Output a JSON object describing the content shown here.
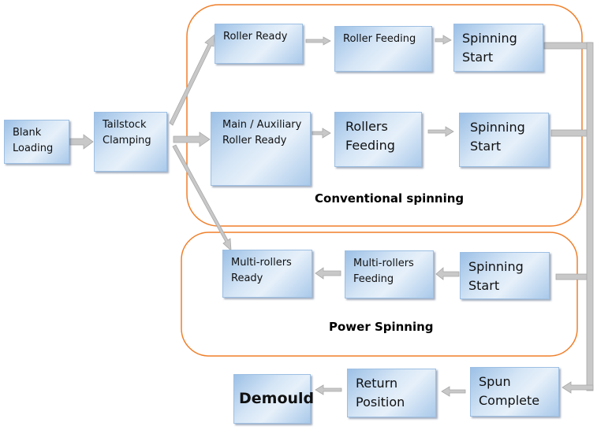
{
  "groups": {
    "conventional": "Conventional spinning",
    "power": "Power Spinning"
  },
  "nodes": {
    "blank_loading": "Blank\nLoading",
    "tailstock_clamping": "Tailstock\nClamping",
    "roller_ready": "Roller Ready",
    "roller_feeding": "Roller Feeding",
    "spinning_start_1": "Spinning\nStart",
    "main_aux_ready": "Main / Auxiliary\nRoller Ready",
    "rollers_feeding": "Rollers\nFeeding",
    "spinning_start_2": "Spinning\nStart",
    "multi_rollers_ready": "Multi-rollers\nReady",
    "multi_rollers_feeding": "Multi-rollers\nFeeding",
    "spinning_start_3": "Spinning\nStart",
    "spun_complete": "Spun\nComplete",
    "return_position": "Return\nPosition",
    "demould": "Demould"
  },
  "colors": {
    "group_border": "#f07f2a",
    "box_top": "#9cc0e6",
    "box_light": "#e6f0fa",
    "connector": "#c8c8c8"
  }
}
